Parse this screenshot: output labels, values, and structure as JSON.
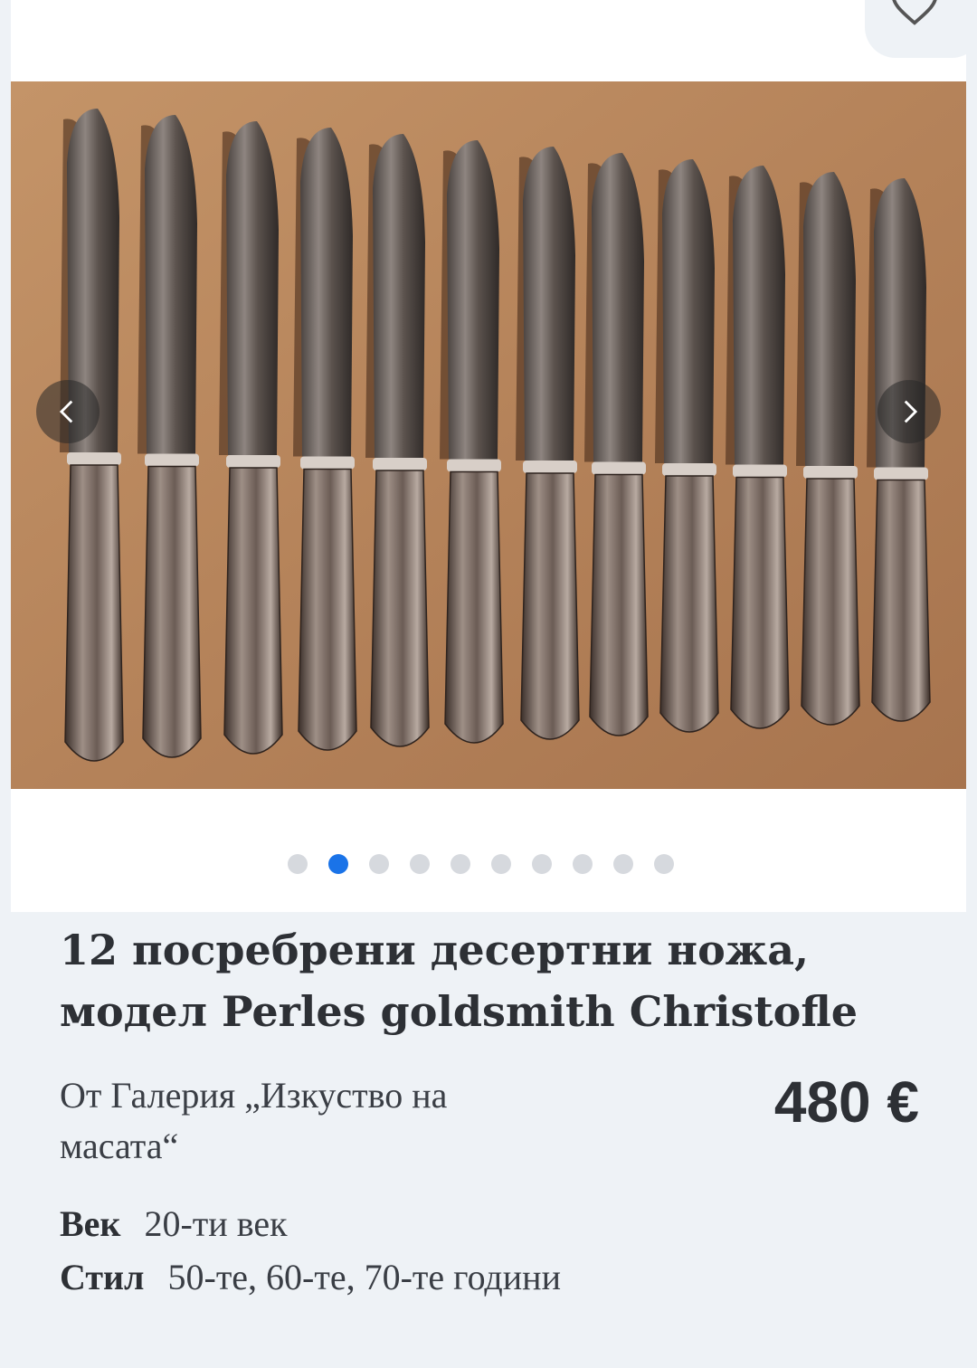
{
  "listing": {
    "title": "12 посребрени десертни ножа, модел Perles goldsmith Christofle",
    "seller": "От  Галерия „Изкуство на масата“",
    "price": "480 €",
    "attributes": [
      {
        "key": "Век",
        "value": "20-ти век"
      },
      {
        "key": "Стил",
        "value": "50-те, 60-те, 70-те години"
      }
    ]
  },
  "gallery": {
    "dots_total": 10,
    "active_index": 1,
    "prev_icon": "chevron-left-icon",
    "next_icon": "chevron-right-icon",
    "favorite_icon": "heart-icon"
  },
  "colors": {
    "accent": "#1a73e8",
    "background": "#eef2f6",
    "table_wood": "#b7875c"
  }
}
